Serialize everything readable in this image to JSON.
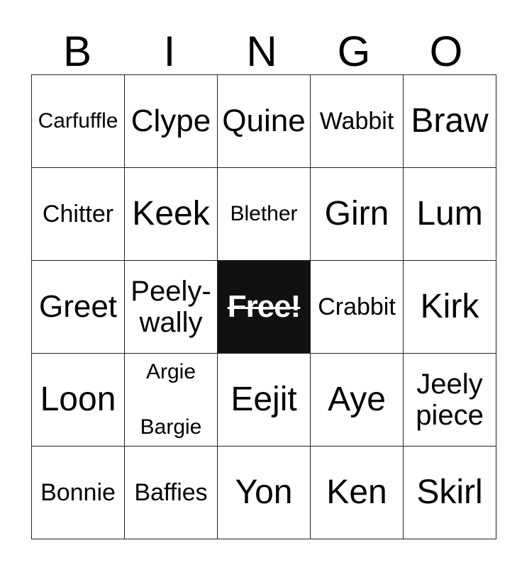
{
  "card": {
    "header_letters": [
      "B",
      "I",
      "N",
      "G",
      "O"
    ],
    "free_space": {
      "label": "Free!",
      "background_color": "#111111",
      "text_color": "#ffffff",
      "struck_through": true
    },
    "border_color": "#222222",
    "background_color": "#ffffff",
    "rows": [
      [
        {
          "text": "Carfuffle",
          "size": "xs"
        },
        {
          "text": "Clype",
          "size": "lg"
        },
        {
          "text": "Quine",
          "size": "lg"
        },
        {
          "text": "Wabbit",
          "size": "sm"
        },
        {
          "text": "Braw",
          "size": "xl"
        }
      ],
      [
        {
          "text": "Chitter",
          "size": "sm"
        },
        {
          "text": "Keek",
          "size": "xl"
        },
        {
          "text": "Blether",
          "size": "xs"
        },
        {
          "text": "Girn",
          "size": "xl"
        },
        {
          "text": "Lum",
          "size": "xl"
        }
      ],
      [
        {
          "text": "Greet",
          "size": "lg"
        },
        {
          "text": "Peely-wally",
          "size": "md",
          "wrap": "two-line"
        },
        {
          "text": "Free!",
          "free": true
        },
        {
          "text": "Crabbit",
          "size": "sm"
        },
        {
          "text": "Kirk",
          "size": "xl"
        }
      ],
      [
        {
          "text": "Loon",
          "size": "xl"
        },
        {
          "text": "Argie Bargie",
          "size": "xs",
          "wrap": "spread-line"
        },
        {
          "text": "Eejit",
          "size": "xl"
        },
        {
          "text": "Aye",
          "size": "xl"
        },
        {
          "text": "Jeely piece",
          "size": "md",
          "wrap": "two-line"
        }
      ],
      [
        {
          "text": "Bonnie",
          "size": "sm"
        },
        {
          "text": "Baffies",
          "size": "sm"
        },
        {
          "text": "Yon",
          "size": "xl"
        },
        {
          "text": "Ken",
          "size": "xl"
        },
        {
          "text": "Skirl",
          "size": "xl"
        }
      ]
    ]
  }
}
